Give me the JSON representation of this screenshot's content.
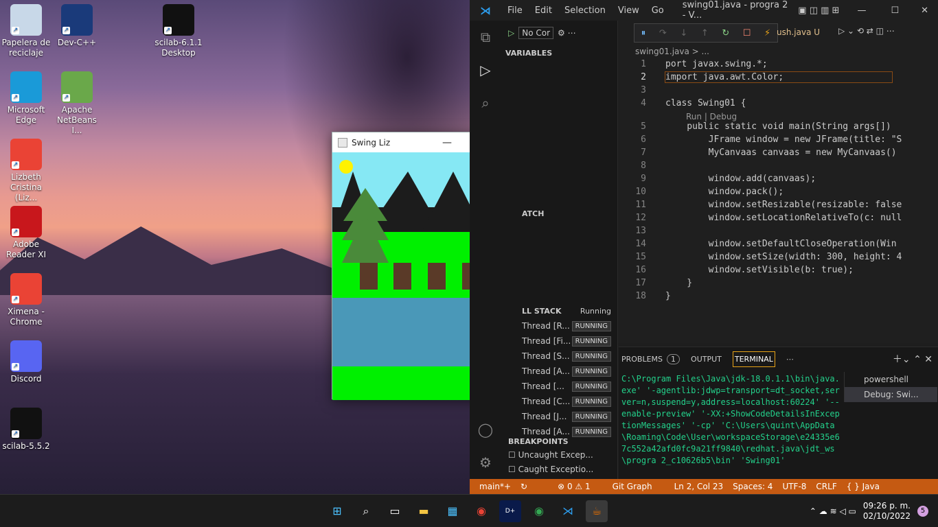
{
  "desktop_icons": [
    {
      "label": "Papelera de reciclaje",
      "icon": "recycle-bin-icon",
      "color": "#c8d8e8"
    },
    {
      "label": "Dev-C++",
      "icon": "devcpp-icon",
      "color": "#1a3a7a"
    },
    {
      "label": "scilab-6.1.1 Desktop",
      "icon": "scilab-icon",
      "color": "#111"
    },
    {
      "label": "Microsoft Edge",
      "icon": "edge-icon",
      "color": "#1a9ad8"
    },
    {
      "label": "Apache NetBeans I...",
      "icon": "netbeans-icon",
      "color": "#6aa84a"
    },
    {
      "label": "Lizbeth Cristina (Liz...",
      "icon": "chrome-icon",
      "color": "#ea4335"
    },
    {
      "label": "Adobe Reader XI",
      "icon": "acrobat-icon",
      "color": "#c8171c"
    },
    {
      "label": "Ximena - Chrome",
      "icon": "chrome-icon",
      "color": "#ea4335"
    },
    {
      "label": "Discord",
      "icon": "discord-icon",
      "color": "#5865f2"
    },
    {
      "label": "scilab-5.5.2",
      "icon": "scilab-icon",
      "color": "#111"
    }
  ],
  "swing": {
    "title": "Swing Liz",
    "minimize": "—",
    "maximize": "☐",
    "close": "✕"
  },
  "vscode": {
    "menu": [
      "File",
      "Edit",
      "Selection",
      "View",
      "Go"
    ],
    "title": "swing01.java - progra 2 - V...",
    "run_config": "No Cor",
    "tab_label": "ush.java U",
    "breadcrumb": "swing01.java > ...",
    "variables": "VARIABLES",
    "watch": "ATCH",
    "callstack": "LL STACK",
    "callstack_state": "Running",
    "threads": [
      {
        "name": "Thread [R...",
        "state": "RUNNING"
      },
      {
        "name": "Thread [Fi...",
        "state": "RUNNING"
      },
      {
        "name": "Thread [S...",
        "state": "RUNNING"
      },
      {
        "name": "Thread [A...",
        "state": "RUNNING"
      },
      {
        "name": "Thread [...",
        "state": "RUNNING"
      },
      {
        "name": "Thread [C...",
        "state": "RUNNING"
      },
      {
        "name": "Thread [J...",
        "state": "RUNNING"
      },
      {
        "name": "Thread [A...",
        "state": "RUNNING"
      }
    ],
    "breakpoints": "BREAKPOINTS",
    "bp_items": [
      "Uncaught Excep...",
      "Caught Exceptio..."
    ],
    "codelens": "Run | Debug",
    "code": [
      {
        "n": "1",
        "t": "port javax.swing.*;"
      },
      {
        "n": "2",
        "t": "import java.awt.Color;"
      },
      {
        "n": "3",
        "t": ""
      },
      {
        "n": "4",
        "t": "class Swing01 {"
      },
      {
        "n": "5",
        "t": "    public static void main(String args[])"
      },
      {
        "n": "6",
        "t": "        JFrame window = new JFrame(title: \"S"
      },
      {
        "n": "7",
        "t": "        MyCanvaas canvaas = new MyCanvaas()"
      },
      {
        "n": "8",
        "t": ""
      },
      {
        "n": "9",
        "t": "        window.add(canvaas);"
      },
      {
        "n": "10",
        "t": "        window.pack();"
      },
      {
        "n": "11",
        "t": "        window.setResizable(resizable: false"
      },
      {
        "n": "12",
        "t": "        window.setLocationRelativeTo(c: null"
      },
      {
        "n": "13",
        "t": ""
      },
      {
        "n": "14",
        "t": "        window.setDefaultCloseOperation(Win"
      },
      {
        "n": "15",
        "t": "        window.setSize(width: 300, height: 4"
      },
      {
        "n": "16",
        "t": "        window.setVisible(b: true);"
      },
      {
        "n": "17",
        "t": "    }"
      },
      {
        "n": "18",
        "t": "}"
      }
    ],
    "panel_tabs": [
      "PROBLEMS",
      "OUTPUT",
      "TERMINAL"
    ],
    "problems_count": "1",
    "terminal_text": "C:\\Program Files\\Java\\jdk-18.0.1.1\\bin\\java.exe' '-agentlib:jdwp=transport=dt_socket,server=n,suspend=y,address=localhost:60224' '--enable-preview' '-XX:+ShowCodeDetailsInExceptionMessages' '-cp' 'C:\\Users\\quint\\AppData\\Roaming\\Code\\User\\workspaceStorage\\e24335e67c552a42afd0fc9a21ff9840\\redhat.java\\jdt_ws\\progra 2_c10626b5\\bin' 'Swing01'",
    "terminals": [
      "powershell",
      "Debug: Swi..."
    ],
    "status": {
      "branch": "main*+",
      "errors": "⊗ 0 ⚠ 1",
      "gitgraph": "Git Graph",
      "pos": "Ln 2, Col 23",
      "spaces": "Spaces: 4",
      "enc": "UTF-8",
      "eol": "CRLF",
      "lang": "{ } Java"
    }
  },
  "taskbar": {
    "time": "09:26 p. m.",
    "date": "02/10/2022",
    "badge": "5"
  }
}
